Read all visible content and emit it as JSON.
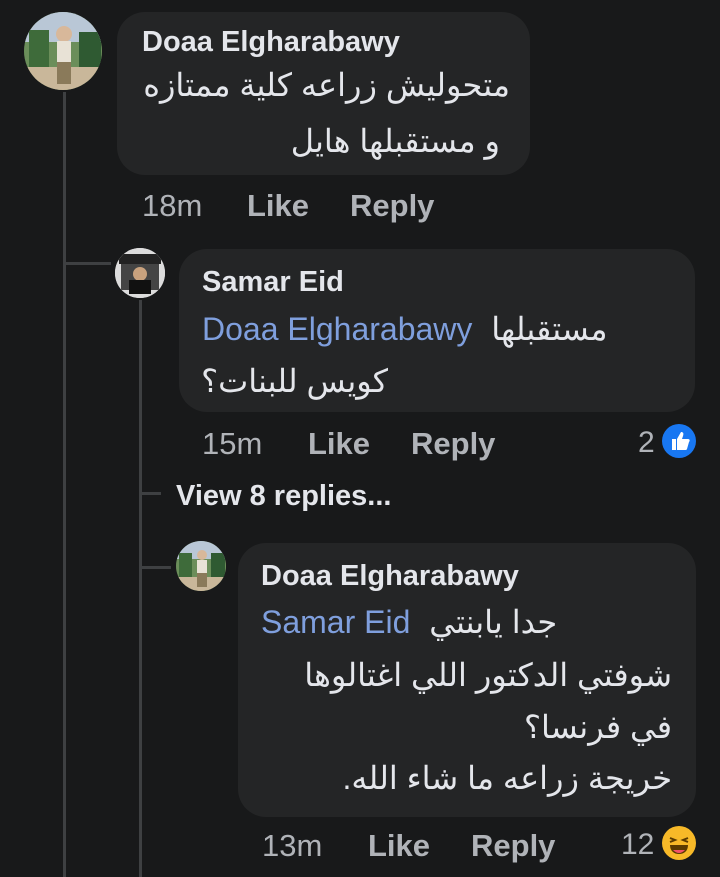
{
  "comments": [
    {
      "author": "Doaa Elgharabawy",
      "lines": [
        "متحوليش زراعه كلية ممتازه",
        "و مستقبلها هايل"
      ],
      "time": "18m",
      "like_label": "Like",
      "reply_label": "Reply"
    },
    {
      "author": "Samar Eid",
      "mention": "Doaa Elgharabawy",
      "mention_suffix": "مستقبلها",
      "lines": [
        "كويس للبنات؟"
      ],
      "time": "15m",
      "like_label": "Like",
      "reply_label": "Reply",
      "reaction_count": "2",
      "reaction_icon": "like-icon",
      "reaction_color": "#1877f2"
    },
    {
      "author": "Doaa Elgharabawy",
      "mention": "Samar Eid",
      "mention_suffix": "جدا يابنتي",
      "lines": [
        "شوفتي الدكتور اللي اغتالوها",
        "في فرنسا؟",
        "خريجة زراعه ما شاء الله."
      ],
      "time": "13m",
      "like_label": "Like",
      "reply_label": "Reply",
      "reaction_count": "12",
      "reaction_icon": "haha-icon",
      "reaction_color": "#f7b928"
    }
  ],
  "view_replies": "View 8 replies..."
}
